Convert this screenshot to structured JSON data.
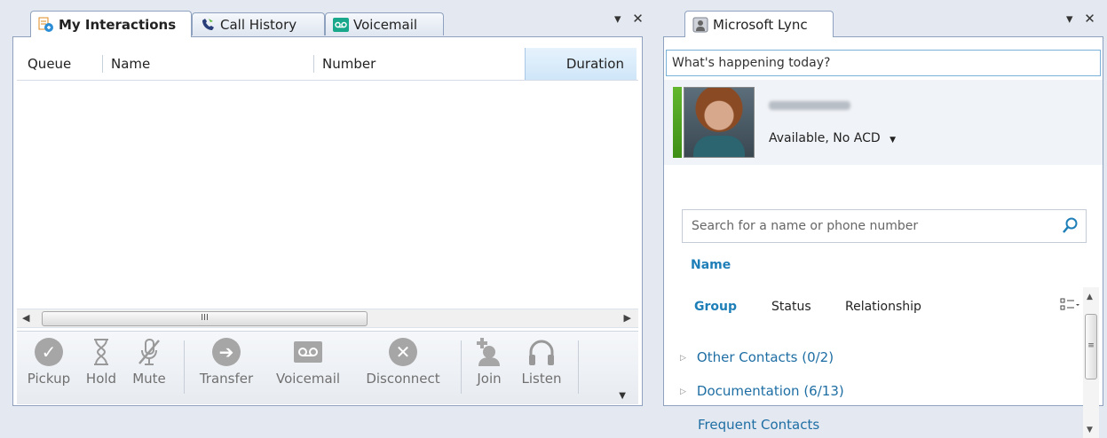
{
  "left_panel": {
    "tabs": [
      {
        "label": "My Interactions",
        "icon": "interactions-icon",
        "active": true
      },
      {
        "label": "Call History",
        "icon": "call-history-icon",
        "active": false
      },
      {
        "label": "Voicemail",
        "icon": "voicemail-icon",
        "active": false
      }
    ],
    "controls": "▾ ✕",
    "grid": {
      "columns": [
        "Queue",
        "Name",
        "Number",
        "Duration"
      ],
      "sorted_column": "Duration",
      "rows": []
    },
    "scroll_thumb_grip": "III",
    "toolbar": [
      {
        "label": "Pickup",
        "icon": "pickup-icon"
      },
      {
        "label": "Hold",
        "icon": "hourglass-icon"
      },
      {
        "label": "Mute",
        "icon": "mute-icon"
      },
      {
        "label": "Transfer",
        "icon": "transfer-icon"
      },
      {
        "label": "Voicemail",
        "icon": "voicemail-icon"
      },
      {
        "label": "Disconnect",
        "icon": "disconnect-icon"
      },
      {
        "label": "Join",
        "icon": "join-icon"
      },
      {
        "label": "Listen",
        "icon": "headphones-icon"
      }
    ]
  },
  "right_panel": {
    "tab": {
      "label": "Microsoft Lync",
      "icon": "lync-contact-icon"
    },
    "controls": "▾ ✕",
    "status_message": "What's happening today?",
    "user": {
      "availability": "Available, No ACD",
      "presence_color": "#4ca51e"
    },
    "search": {
      "placeholder": "Search for a name or phone number"
    },
    "name_heading": "Name",
    "filters": [
      "Group",
      "Status",
      "Relationship"
    ],
    "active_filter": "Group",
    "groups": [
      {
        "label": "Other Contacts (0/2)",
        "expandable": true
      },
      {
        "label": "Documentation (6/13)",
        "expandable": true
      },
      {
        "label": "Frequent Contacts",
        "expandable": false
      }
    ]
  },
  "colors": {
    "accent": "#1e7fb8",
    "border": "#8ea2bf",
    "background": "#e4e9f1"
  }
}
